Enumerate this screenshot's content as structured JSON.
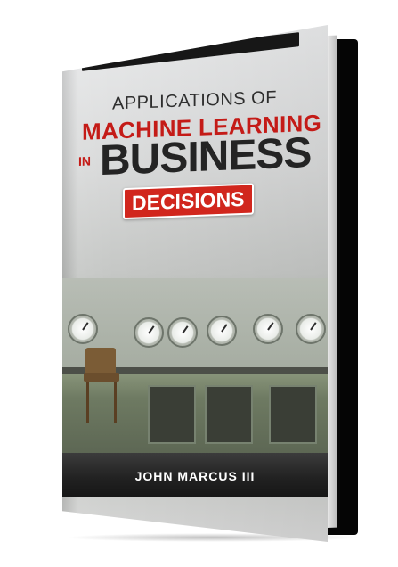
{
  "book": {
    "title_line1": "APPLICATIONS OF",
    "title_line2": "MACHINE LEARNING",
    "title_in": "IN",
    "title_line3": "BUSINESS",
    "title_badge": "DECISIONS",
    "author": "JOHN MARCUS III"
  },
  "colors": {
    "accent_red": "#c41b17",
    "badge_red": "#d1261d",
    "title_dark": "#242424",
    "author_band": "#222222"
  }
}
